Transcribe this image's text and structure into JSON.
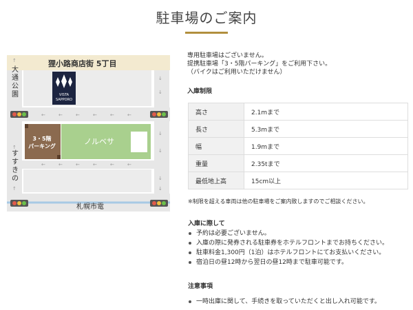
{
  "page": {
    "title": "駐車場のご案内",
    "accent_color": "#b18f3d"
  },
  "map": {
    "street_top": "狸小路商店街 5丁目",
    "street_bottom": "札幌市電",
    "left_top": "大通公園",
    "left_bottom": "すすきの",
    "parking_line1": "3・5階",
    "parking_line2": "パーキング",
    "building": "ノルベサ",
    "logo_line1": "VISTA",
    "logo_line2": "SAPPORO",
    "icons": [
      "traffic-light-icon",
      "arrow-icon",
      "hotel-logo-icon"
    ],
    "colors": {
      "road": "#e7e7e7",
      "parking": "#8b6a4f",
      "norbesa": "#a9d08e",
      "tram": "#a7c9e4",
      "street_band": "#f3ead0"
    }
  },
  "intro": {
    "line1": "専用駐車場はございません。",
    "line2": "提携駐車場「3・5階パーキング」をご利用下さい。",
    "line3": "（バイクはご利用いただけません）"
  },
  "limits": {
    "heading": "入庫制限",
    "rows": [
      {
        "key": "高さ",
        "value": "2.1mまで"
      },
      {
        "key": "長さ",
        "value": "5.3mまで"
      },
      {
        "key": "幅",
        "value": "1.9mまで"
      },
      {
        "key": "重量",
        "value": "2.35tまで"
      },
      {
        "key": "最低地上高",
        "value": "15cm以上"
      }
    ],
    "note": "※制限を超える車両は他の駐車場をご案内致しますのでご相談ください。"
  },
  "entry": {
    "heading": "入庫に際して",
    "items": [
      "予約は必要ございません。",
      "入庫の際に発券される駐車券をホテルフロントまでお持ちください。",
      "駐車料金1,300円（1泊）はホテルフロントにてお支払いください。",
      "宿泊日の昼12時から翌日の昼12時まで駐車可能です。"
    ]
  },
  "caution": {
    "heading": "注意事項",
    "items": [
      "一時出庫に関して、手続きを取っていただくと出し入れ可能です。"
    ]
  }
}
